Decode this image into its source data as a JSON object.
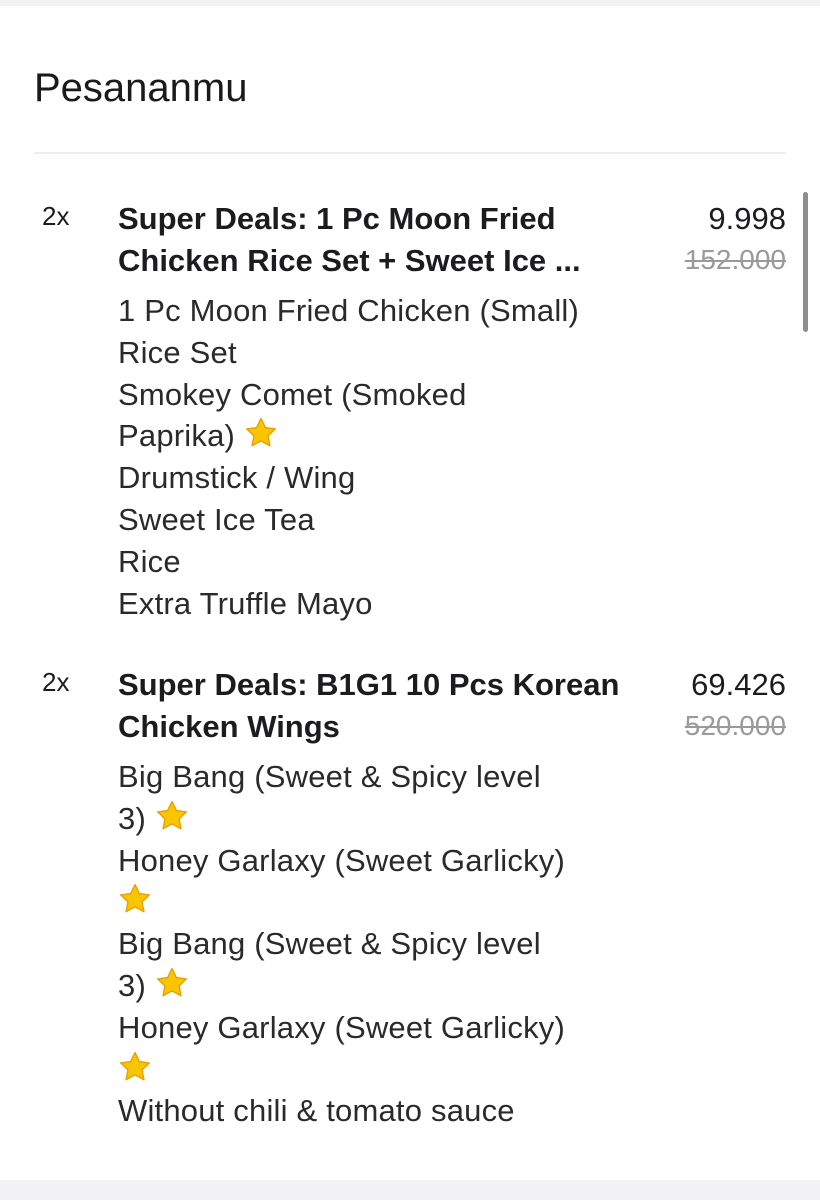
{
  "header": {
    "title": "Pesananmu"
  },
  "icons": {
    "star": "star-icon",
    "star_color": "#F9C400",
    "star_outline_color": "#E8A200"
  },
  "colors": {
    "text": "#1c1c1e",
    "strikethrough_price": "#9a9a9a",
    "divider": "#ededed",
    "background": "#ffffff"
  },
  "items": [
    {
      "qty": "2x",
      "name": "Super Deals: 1 Pc Moon Fried Chicken Rice Set + Sweet Ice ...",
      "price": "9.998",
      "original_price": "152.000",
      "options": [
        "1 Pc Moon Fried Chicken (Small)",
        "Rice Set",
        "Smokey Comet (Smoked",
        "Paprika)",
        "Drumstick / Wing",
        "Sweet Ice Tea",
        "Rice",
        "Extra Truffle Mayo"
      ]
    },
    {
      "qty": "2x",
      "name": "Super Deals: B1G1 10 Pcs Korean Chicken Wings",
      "price": "69.426",
      "original_price": "520.000",
      "options": [
        "Big Bang (Sweet & Spicy level",
        "3)",
        "Honey Garlaxy (Sweet Garlicky)",
        "",
        "Big Bang (Sweet & Spicy level",
        "3)",
        "Honey Garlaxy (Sweet Garlicky)",
        "",
        "Without  chili & tomato sauce"
      ]
    }
  ]
}
